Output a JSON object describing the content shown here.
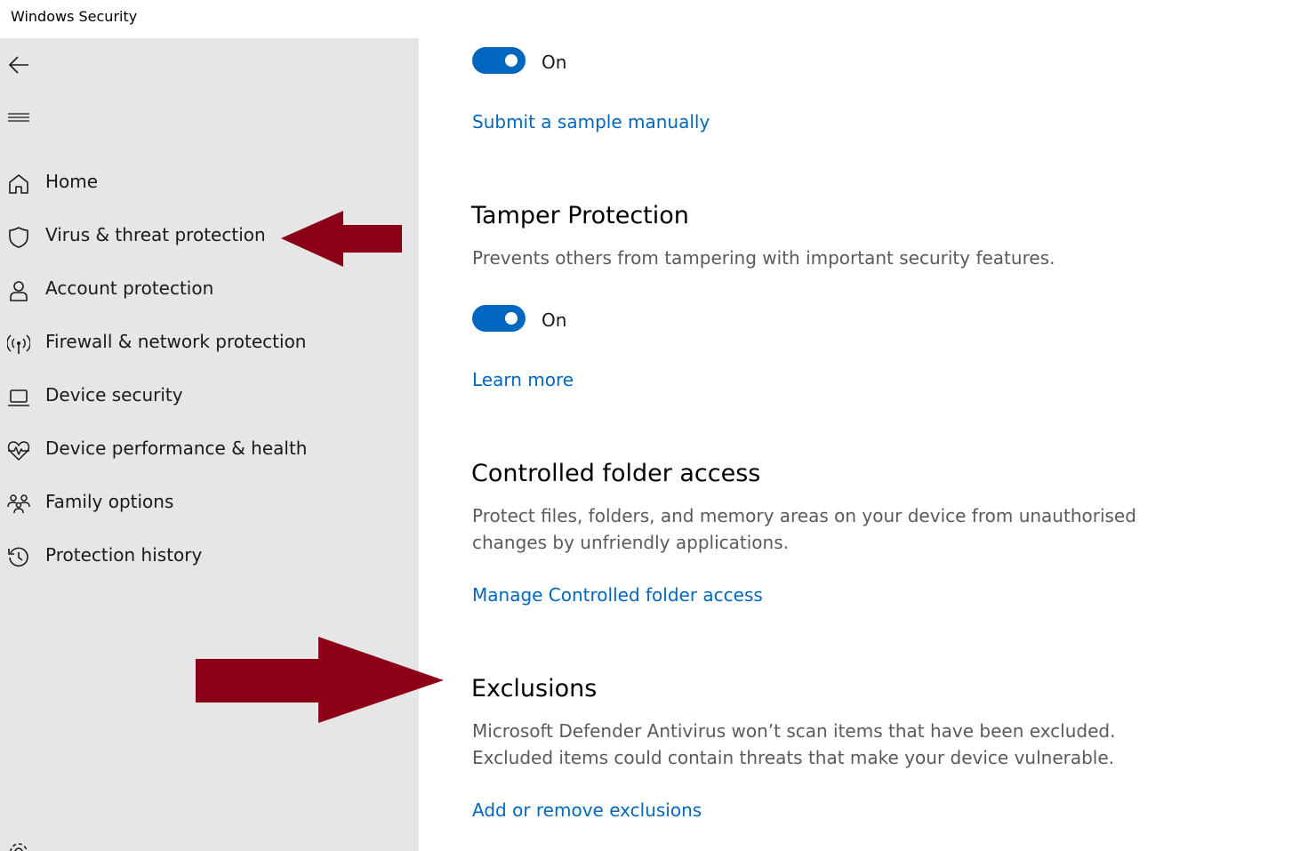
{
  "window": {
    "title": "Windows Security"
  },
  "sidebar": {
    "back_icon": "back-arrow-icon",
    "menu_icon": "hamburger-menu-icon",
    "items": [
      {
        "label": "Home",
        "icon": "home-icon"
      },
      {
        "label": "Virus & threat protection",
        "icon": "shield-icon"
      },
      {
        "label": "Account protection",
        "icon": "person-icon"
      },
      {
        "label": "Firewall & network protection",
        "icon": "antenna-icon"
      },
      {
        "label": "Device security",
        "icon": "laptop-icon"
      },
      {
        "label": "Device performance & health",
        "icon": "heart-pulse-icon"
      },
      {
        "label": "Family options",
        "icon": "family-icon"
      },
      {
        "label": "Protection history",
        "icon": "history-icon"
      }
    ],
    "settings_icon": "gear-icon"
  },
  "annotation": {
    "arrow_color": "#8b0016"
  },
  "main": {
    "sample_submission": {
      "toggle_state": "On",
      "link": "Submit a sample manually"
    },
    "tamper_protection": {
      "title": "Tamper Protection",
      "description": "Prevents others from tampering with important security features.",
      "toggle_state": "On",
      "link": "Learn more"
    },
    "controlled_folder_access": {
      "title": "Controlled folder access",
      "description": "Protect files, folders, and memory areas on your device from unauthorised changes by unfriendly applications.",
      "link": "Manage Controlled folder access"
    },
    "exclusions": {
      "title": "Exclusions",
      "description": "Microsoft Defender Antivirus won’t scan items that have been excluded. Excluded items could contain threats that make your device vulnerable.",
      "link": "Add or remove exclusions"
    }
  },
  "colors": {
    "accent": "#0067c0",
    "sidebar_bg": "#e6e6e6"
  }
}
